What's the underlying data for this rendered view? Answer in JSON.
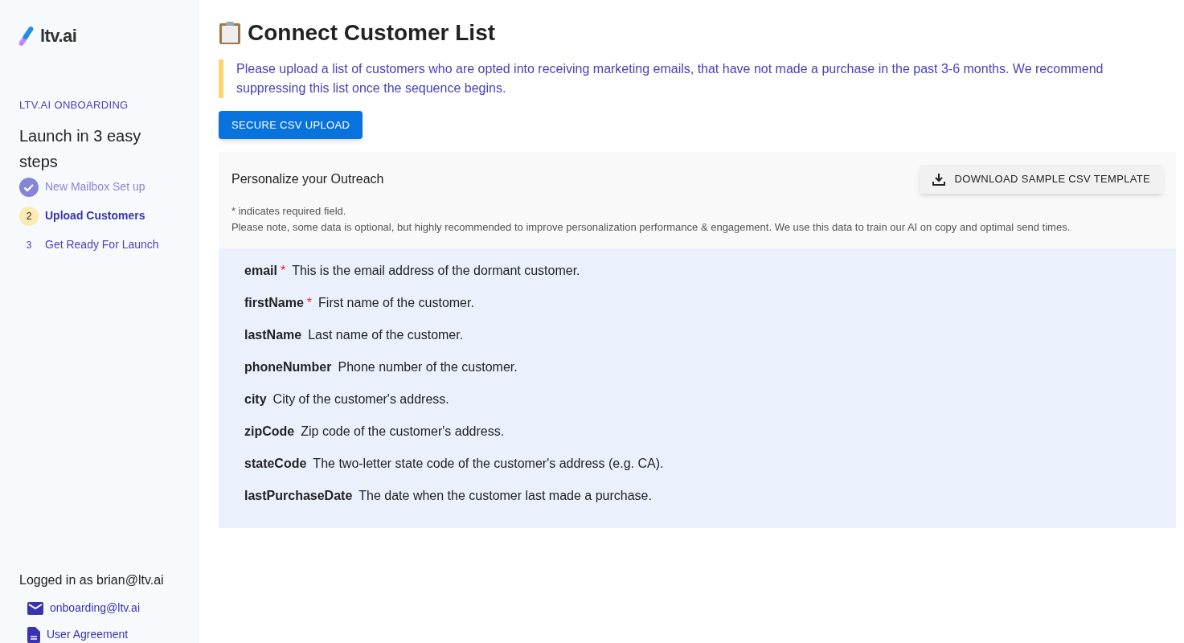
{
  "sidebar": {
    "logo": "ltv.ai",
    "section_label": "LTV.AI ONBOARDING",
    "heading": "Launch in 3 easy steps",
    "steps": [
      {
        "label": "New Mailbox Set up",
        "completed": true,
        "selected": false
      },
      {
        "number": "2",
        "label": "Upload Customers",
        "completed": false,
        "selected": true
      },
      {
        "number": "3",
        "label": "Get Ready For Launch",
        "completed": false,
        "selected": false
      }
    ],
    "logged_in": "Logged in as brian@ltv.ai",
    "links": [
      {
        "kind": "mail",
        "label": "onboarding@ltv.ai"
      },
      {
        "kind": "document",
        "label": "User Agreement"
      }
    ]
  },
  "main": {
    "title": "Connect Customer List",
    "notice": "Please upload a list of customers who are opted into receiving marketing emails, that have not made a purchase in the past 3-6 months. We recommend suppressing this list once the sequence begins.",
    "upload_button": "SECURE CSV UPLOAD",
    "panel": {
      "title": "Personalize your Outreach",
      "download_button": "DOWNLOAD SAMPLE CSV TEMPLATE",
      "required_note": "* indicates required field.",
      "required_symbol": "*",
      "note": "Please note, some data is optional, but highly recommended to improve personalization performance & engagement. We use this data to train our AI on copy and optimal send times.",
      "fields": [
        {
          "name": "email",
          "required": true,
          "description": "This is the email address of the dormant customer."
        },
        {
          "name": "firstName",
          "required": true,
          "description": "First name of the customer."
        },
        {
          "name": "lastName",
          "required": false,
          "description": "Last name of the customer."
        },
        {
          "name": "phoneNumber",
          "required": false,
          "description": "Phone number of the customer."
        },
        {
          "name": "city",
          "required": false,
          "description": "City of the customer's address."
        },
        {
          "name": "zipCode",
          "required": false,
          "description": "Zip code of the customer's address."
        },
        {
          "name": "stateCode",
          "required": false,
          "description": "The two-letter state code of the customer's address (e.g. CA)."
        },
        {
          "name": "lastPurchaseDate",
          "required": false,
          "description": "The date when the customer last made a purchase."
        }
      ]
    }
  }
}
